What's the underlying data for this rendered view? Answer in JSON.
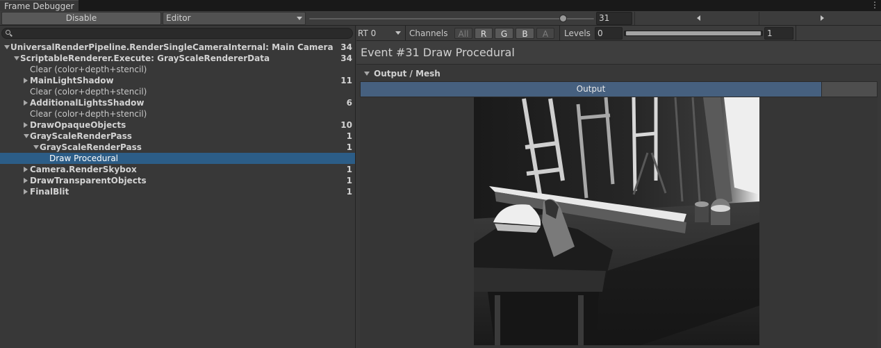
{
  "window": {
    "title": "Frame Debugger",
    "menu_glyph": "⋮"
  },
  "toolbar": {
    "disable_label": "Disable",
    "target_label": "Editor",
    "event_index": "31",
    "event_slider_fraction": 1.0
  },
  "search": {
    "placeholder": ""
  },
  "tree": {
    "items": [
      {
        "label": "UniversalRenderPipeline.RenderSingleCameraInternal: Main Camera",
        "count": "34",
        "depth": 0,
        "fold": "open",
        "bold": true
      },
      {
        "label": "ScriptableRenderer.Execute: GrayScaleRendererData",
        "count": "34",
        "depth": 1,
        "fold": "open",
        "bold": true
      },
      {
        "label": "Clear (color+depth+stencil)",
        "count": "",
        "depth": 2,
        "fold": "none",
        "bold": false
      },
      {
        "label": "MainLightShadow",
        "count": "11",
        "depth": 2,
        "fold": "closed",
        "bold": true
      },
      {
        "label": "Clear (color+depth+stencil)",
        "count": "",
        "depth": 2,
        "fold": "none",
        "bold": false
      },
      {
        "label": "AdditionalLightsShadow",
        "count": "6",
        "depth": 2,
        "fold": "closed",
        "bold": true
      },
      {
        "label": "Clear (color+depth+stencil)",
        "count": "",
        "depth": 2,
        "fold": "none",
        "bold": false
      },
      {
        "label": "DrawOpaqueObjects",
        "count": "10",
        "depth": 2,
        "fold": "closed",
        "bold": true
      },
      {
        "label": "GrayScaleRenderPass",
        "count": "1",
        "depth": 2,
        "fold": "open",
        "bold": true
      },
      {
        "label": "GrayScaleRenderPass",
        "count": "1",
        "depth": 3,
        "fold": "open",
        "bold": true
      },
      {
        "label": "Draw Procedural",
        "count": "",
        "depth": 4,
        "fold": "none",
        "bold": false,
        "selected": true
      },
      {
        "label": "Camera.RenderSkybox",
        "count": "1",
        "depth": 2,
        "fold": "closed",
        "bold": true
      },
      {
        "label": "DrawTransparentObjects",
        "count": "1",
        "depth": 2,
        "fold": "closed",
        "bold": true
      },
      {
        "label": "FinalBlit",
        "count": "1",
        "depth": 2,
        "fold": "closed",
        "bold": true
      }
    ]
  },
  "render_target": {
    "rt_label": "RT 0",
    "channels_label": "Channels",
    "channels": [
      {
        "label": "All",
        "on": false
      },
      {
        "label": "R",
        "on": true
      },
      {
        "label": "G",
        "on": true
      },
      {
        "label": "B",
        "on": true
      },
      {
        "label": "A",
        "on": false
      }
    ],
    "levels_label": "Levels",
    "levels_min": "0",
    "levels_max": "1"
  },
  "event": {
    "title": "Event #31 Draw Procedural",
    "section_label": "Output / Mesh",
    "tab_output": "Output"
  },
  "colors": {
    "selection": "#2c5d87",
    "tab_active": "#46607f"
  }
}
